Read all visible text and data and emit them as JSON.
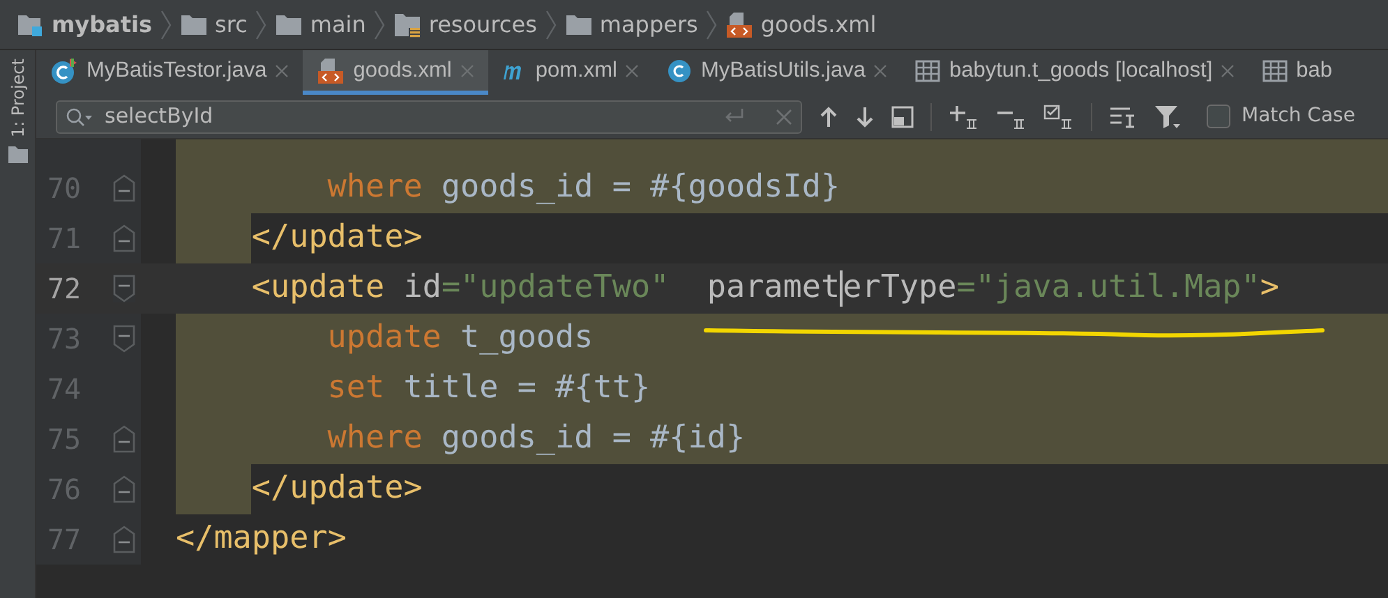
{
  "breadcrumb": [
    {
      "label": "mybatis",
      "kind": "module"
    },
    {
      "label": "src",
      "kind": "folder"
    },
    {
      "label": "main",
      "kind": "folder"
    },
    {
      "label": "resources",
      "kind": "resources"
    },
    {
      "label": "mappers",
      "kind": "folder"
    },
    {
      "label": "goods.xml",
      "kind": "xml"
    }
  ],
  "side_panel": {
    "label": "1: Project"
  },
  "tabs": [
    {
      "label": "MyBatisTestor.java",
      "kind": "runnable-class",
      "selected": false,
      "closable": true
    },
    {
      "label": "goods.xml",
      "kind": "xml",
      "selected": true,
      "closable": true
    },
    {
      "label": "pom.xml",
      "kind": "maven",
      "selected": false,
      "closable": true
    },
    {
      "label": "MyBatisUtils.java",
      "kind": "class",
      "selected": false,
      "closable": true
    },
    {
      "label": "babytun.t_goods [localhost]",
      "kind": "table",
      "selected": false,
      "closable": true
    },
    {
      "label": "bab",
      "kind": "table",
      "selected": false,
      "closable": false
    }
  ],
  "find_bar": {
    "query": "selectById",
    "match_case": {
      "label": "Match Case",
      "checked": false
    }
  },
  "editor": {
    "lines": [
      {
        "number": "70",
        "highlighted": true,
        "indent_highlighted": true,
        "current": false,
        "tokens": [
          {
            "kind": "keyword",
            "text": "        where"
          },
          {
            "kind": "text",
            "text": " goods_id = #{goodsId}"
          }
        ]
      },
      {
        "number": "71",
        "highlighted": false,
        "indent_highlighted": true,
        "current": false,
        "tokens": [
          {
            "kind": "tag",
            "text": "    </update>"
          }
        ]
      },
      {
        "number": "72",
        "highlighted": false,
        "indent_highlighted": false,
        "current": true,
        "tokens": [
          {
            "kind": "tag",
            "text": "    <update "
          },
          {
            "kind": "attr",
            "text": "id"
          },
          {
            "kind": "string",
            "text": "=\"updateTwo\""
          },
          {
            "kind": "attr",
            "text": "  paramet"
          },
          {
            "kind": "caret"
          },
          {
            "kind": "attr",
            "text": "erType"
          },
          {
            "kind": "string",
            "text": "=\"java.util.Map\""
          },
          {
            "kind": "tag",
            "text": ">"
          }
        ]
      },
      {
        "number": "73",
        "highlighted": true,
        "indent_highlighted": true,
        "current": false,
        "tokens": [
          {
            "kind": "keyword",
            "text": "        update"
          },
          {
            "kind": "text",
            "text": " t_goods"
          }
        ]
      },
      {
        "number": "74",
        "highlighted": true,
        "indent_highlighted": true,
        "current": false,
        "tokens": [
          {
            "kind": "keyword",
            "text": "        set"
          },
          {
            "kind": "text",
            "text": " title = #{tt}"
          }
        ]
      },
      {
        "number": "75",
        "highlighted": true,
        "indent_highlighted": true,
        "current": false,
        "tokens": [
          {
            "kind": "keyword",
            "text": "        where"
          },
          {
            "kind": "text",
            "text": " goods_id = #{id}"
          }
        ]
      },
      {
        "number": "76",
        "highlighted": false,
        "indent_highlighted": true,
        "current": false,
        "tokens": [
          {
            "kind": "tag",
            "text": "    </update>"
          }
        ]
      },
      {
        "number": "77",
        "highlighted": false,
        "current": false,
        "tokens": [
          {
            "kind": "tag",
            "text": "</mapper>"
          }
        ]
      }
    ]
  }
}
